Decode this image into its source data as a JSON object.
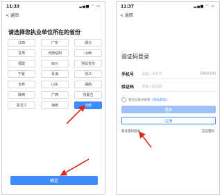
{
  "colors": {
    "accent": "#3f8bff",
    "arrow": "#e0281b",
    "accent_light": "#9ec2f7"
  },
  "left": {
    "status_time": "11:33",
    "status_icons": "▂▄▆ ◠ ▭",
    "back_label": "< 返回",
    "title": "请选择您执业单位所在的省份",
    "provinces": [
      "江西",
      "广东",
      "湖北",
      "甘肃",
      "河南信阳",
      "山西",
      "福建",
      "四川",
      "测试省份",
      "宁夏",
      "青海",
      "浙江",
      "吉林",
      "山东",
      "湖南",
      "陕西",
      "广西",
      "内蒙古",
      "黑龙江",
      "海南",
      "河南"
    ],
    "selected_index": 20,
    "confirm_label": "确定"
  },
  "right": {
    "status_time": "11:37",
    "status_icons": "▂▄▆ ◠ ▭",
    "back_label": "< 返回",
    "title": "验证码登录",
    "phone_label": "手机号",
    "phone_placeholder": "请输入手机号",
    "get_code_label": "获取验证码",
    "code_label": "验证码",
    "code_placeholder": "请输入验证码",
    "agree_text": "我已同意并接受",
    "agree_link": "《隐私政策》",
    "login_label": "登录",
    "register_label": "注册",
    "password_login_label": "账号密码登录",
    "forgot_label": "忘记密码"
  }
}
